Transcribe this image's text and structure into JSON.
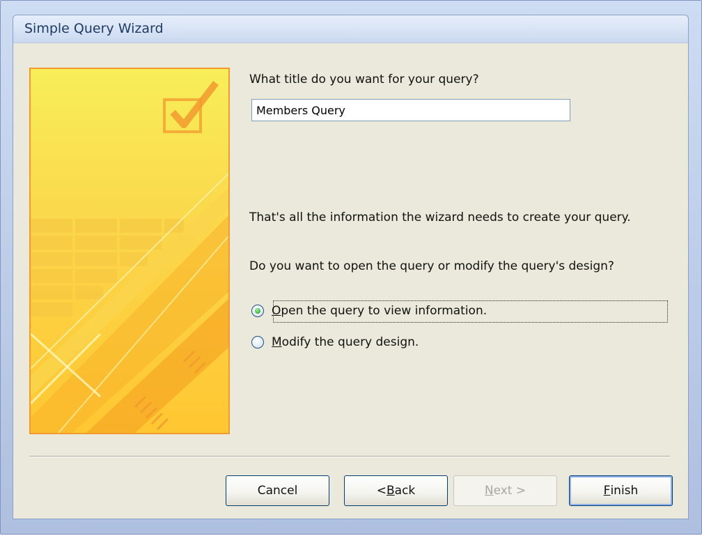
{
  "window": {
    "title": "Simple Query Wizard"
  },
  "content": {
    "question": "What title do you want for your query?",
    "query_title_value": "Members Query",
    "info_text": "That's all the information the wizard needs to create your query.",
    "prompt": "Do you want to open the query or modify the query's design?",
    "options": [
      {
        "label": "Open the query to view information.",
        "accelerator": "O",
        "rest": "pen the query to view information.",
        "selected": true
      },
      {
        "label": "Modify the query design.",
        "accelerator": "M",
        "rest": "odify the query design.",
        "selected": false
      }
    ]
  },
  "buttons": {
    "cancel": "Cancel",
    "back_prefix": "< ",
    "back_accel": "B",
    "back_rest": "ack",
    "next_accel": "N",
    "next_rest": "ext >",
    "finish_accel": "F",
    "finish_rest": "inish",
    "next_enabled": false
  },
  "colors": {
    "client_bg": "#ebe9db",
    "title_text": "#1e3a66",
    "art_border": "#f29a2e"
  },
  "icons": [
    "checkbox-check-icon",
    "radio-selected-icon",
    "radio-unselected-icon"
  ]
}
